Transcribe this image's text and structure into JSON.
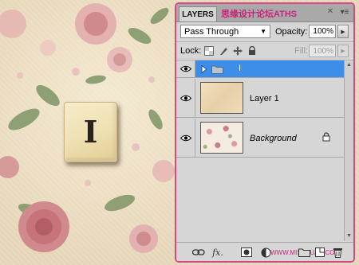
{
  "canvas": {
    "tile_letter": "I",
    "colors": {
      "paper": "#e9d9bd",
      "rose": "#d08a8e",
      "leaf": "#7f9566",
      "tile": "#efe0b2",
      "letter": "#2a231c"
    }
  },
  "panel": {
    "tab_label": "LAYERS",
    "tab_overlay": "思缘设计论坛",
    "tab_overlay_tail": "ATHS",
    "watermark_top": "www.MISSYUAN.COM",
    "watermark_bottom": "WWW.MISSYUAN.COM",
    "accent_border": "#d84880"
  },
  "options": {
    "blend_mode": "Pass Through",
    "opacity_label": "Opacity:",
    "opacity_value": "100%"
  },
  "lock": {
    "label": "Lock:",
    "icons": [
      "lock-transparent-icon",
      "lock-image-icon",
      "lock-position-icon",
      "lock-all-icon"
    ],
    "fill_label": "Fill:",
    "fill_value": "100%"
  },
  "layers": [
    {
      "name": "I",
      "type": "group",
      "selected": true,
      "visible": true
    },
    {
      "name": "Layer 1",
      "type": "pixel",
      "selected": false,
      "visible": true
    },
    {
      "name": "Background",
      "type": "background",
      "selected": false,
      "visible": true,
      "locked": true
    }
  ],
  "bottom_bar": {
    "icons": [
      "link-layers-icon",
      "fx-icon",
      "layer-mask-icon",
      "adjustment-layer-icon",
      "new-group-icon",
      "new-layer-icon",
      "trash-icon"
    ],
    "fx_label": "fx."
  }
}
